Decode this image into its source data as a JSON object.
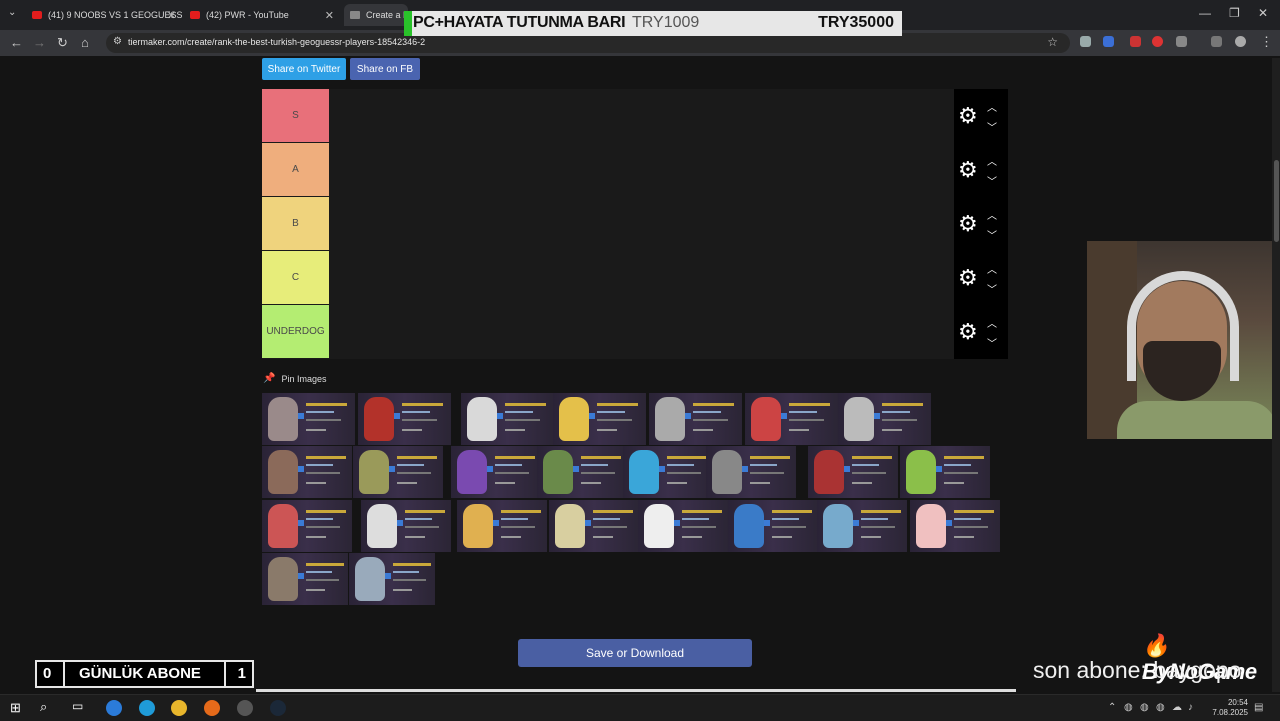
{
  "browser": {
    "tabs": [
      {
        "title": "(41) 9 NOOBS VS 1 GEOGUESSR",
        "active": false
      },
      {
        "title": "(42) PWR - YouTube",
        "active": false
      },
      {
        "title": "Create a R",
        "active": true
      }
    ],
    "url": "tiermaker.com/create/rank-the-best-turkish-geoguessr-players-18542346-2",
    "window_controls": {
      "minimize": "—",
      "maximize": "❐",
      "close": "✕"
    }
  },
  "stream_overlay": {
    "goal_label": "PC+HAYATA TUTUNMA BARI",
    "goal_current": "TRY1009",
    "goal_target": "TRY35000",
    "daily_subs_label": "GÜNLÜK ABONE",
    "daily_subs_left": "0",
    "daily_subs_right": "1",
    "brand": "ByNoGame",
    "last_sub_label": "son abone: baygopo"
  },
  "page": {
    "share_twitter": "Share on Twitter",
    "share_fb": "Share on FB",
    "tiers": [
      {
        "label": "S",
        "color": "#e8707a"
      },
      {
        "label": "A",
        "color": "#efae7d"
      },
      {
        "label": "B",
        "color": "#efd37d"
      },
      {
        "label": "C",
        "color": "#e7ed7a"
      },
      {
        "label": "UNDERDOG",
        "color": "#b4ed72"
      }
    ],
    "pin_images": "Pin Images",
    "save_button": "Save or Download"
  },
  "taskbar": {
    "time": "20:54",
    "date": "7.08.2025"
  }
}
